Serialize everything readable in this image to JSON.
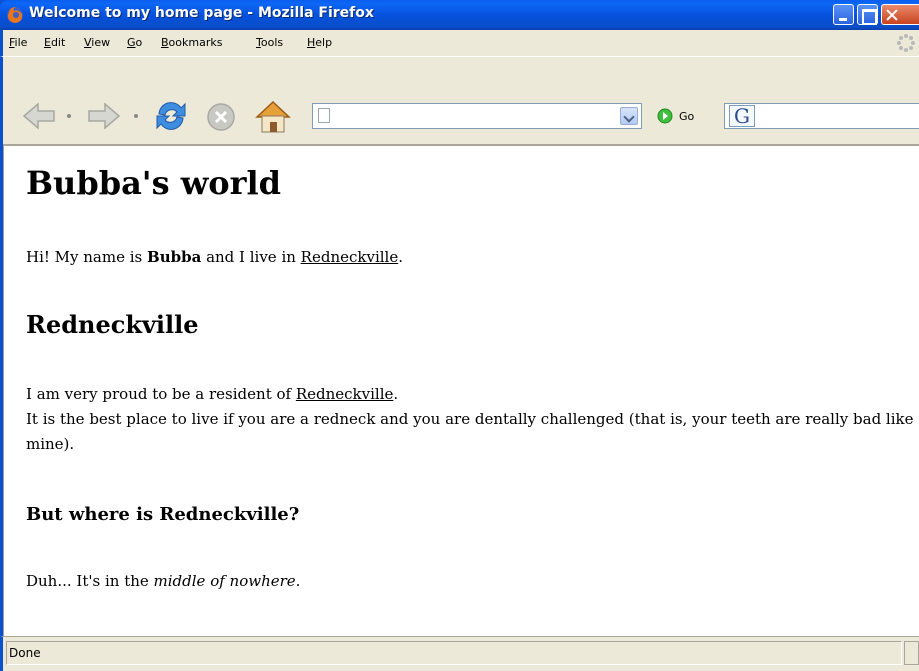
{
  "window": {
    "title": "Welcome to my home page - Mozilla Firefox"
  },
  "menu": {
    "items": [
      {
        "label": "File",
        "acc": "F",
        "rest": "ile"
      },
      {
        "label": "Edit",
        "acc": "E",
        "rest": "dit"
      },
      {
        "label": "View",
        "acc": "V",
        "rest": "iew"
      },
      {
        "label": "Go",
        "acc": "G",
        "rest": "o"
      },
      {
        "label": "Bookmarks",
        "acc": "B",
        "rest": "ookmarks"
      },
      {
        "label": "Tools",
        "acc": "T",
        "rest": "ools"
      },
      {
        "label": "Help",
        "acc": "H",
        "rest": "elp"
      }
    ]
  },
  "toolbar": {
    "url_value": "",
    "go_label": "Go",
    "search_value": "",
    "icons": [
      "back-icon",
      "forward-icon",
      "reload-icon",
      "stop-icon",
      "home-icon",
      "go-icon",
      "google-search-icon"
    ]
  },
  "page": {
    "h1": "Bubba's world",
    "p1_before": "Hi! My name is ",
    "p1_bold": "Bubba",
    "p1_middle": " and I live in ",
    "p1_link": "Redneckville",
    "p1_after": ".",
    "h2": "Redneckville",
    "p2_before": "I am very proud to be a resident of ",
    "p2_link": "Redneckville",
    "p2_after": ".",
    "p2_line2": "It is the best place to live if you are a redneck and you are dentally challenged (that is, your teeth are really bad like mine).",
    "h3": "But where is Redneckville?",
    "p3_before": "Duh... It's in the ",
    "p3_italic": "middle of nowhere",
    "p3_after": "."
  },
  "status": {
    "text": "Done"
  }
}
